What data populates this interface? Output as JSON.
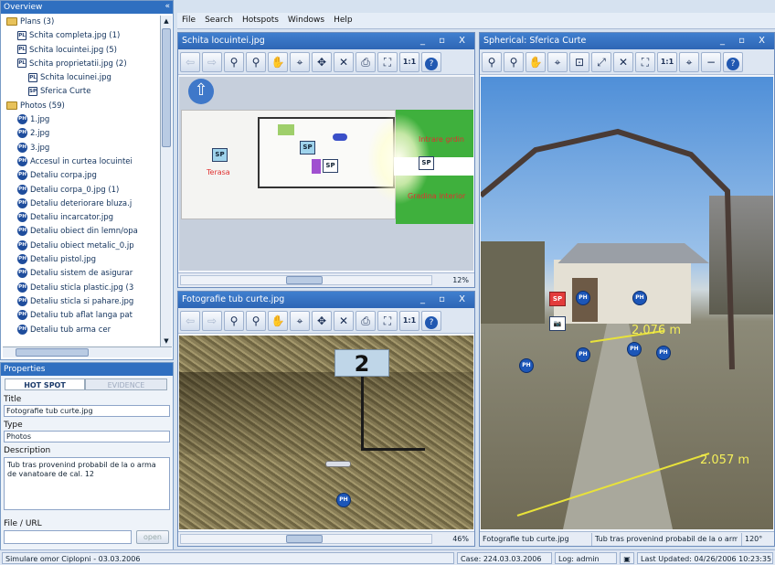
{
  "overview": {
    "title": "Overview",
    "tree": [
      {
        "level": 0,
        "icon": "folder",
        "label": "Plans (3)"
      },
      {
        "level": 1,
        "icon": "PL",
        "label": "Schita completa.jpg (1)"
      },
      {
        "level": 1,
        "icon": "PL",
        "label": "Schita locuintei.jpg (5)"
      },
      {
        "level": 1,
        "icon": "PL",
        "label": "Schita proprietatii.jpg (2)"
      },
      {
        "level": 2,
        "icon": "PL",
        "label": "Schita locuinei.jpg"
      },
      {
        "level": 2,
        "icon": "SP",
        "label": "Sferica Curte"
      },
      {
        "level": 0,
        "icon": "folder",
        "label": "Photos (59)"
      },
      {
        "level": 1,
        "icon": "PH",
        "label": "1.jpg"
      },
      {
        "level": 1,
        "icon": "PH",
        "label": "2.jpg"
      },
      {
        "level": 1,
        "icon": "PH",
        "label": "3.jpg"
      },
      {
        "level": 1,
        "icon": "PH",
        "label": "Accesul in curtea locuintei"
      },
      {
        "level": 1,
        "icon": "PH",
        "label": "Detaliu corpa.jpg"
      },
      {
        "level": 1,
        "icon": "PH",
        "label": "Detaliu corpa_0.jpg (1)"
      },
      {
        "level": 1,
        "icon": "PH",
        "label": "Detaliu deteriorare bluza.j"
      },
      {
        "level": 1,
        "icon": "PH",
        "label": "Detaliu incarcator.jpg"
      },
      {
        "level": 1,
        "icon": "PH",
        "label": "Detaliu obiect din lemn/opa"
      },
      {
        "level": 1,
        "icon": "PH",
        "label": "Detaliu obiect metalic_0.jp"
      },
      {
        "level": 1,
        "icon": "PH",
        "label": "Detaliu pistol.jpg"
      },
      {
        "level": 1,
        "icon": "PH",
        "label": "Detaliu sistem de asigurar"
      },
      {
        "level": 1,
        "icon": "PH",
        "label": "Detaliu sticla plastic.jpg (3"
      },
      {
        "level": 1,
        "icon": "PH",
        "label": "Detaliu sticla si pahare.jpg"
      },
      {
        "level": 1,
        "icon": "PH",
        "label": "Detaliu tub aflat langa pat"
      },
      {
        "level": 1,
        "icon": "PH",
        "label": "Detaliu tub arma cer"
      }
    ]
  },
  "properties": {
    "title": "Properties",
    "tabs": [
      "HOT SPOT",
      "EVIDENCE"
    ],
    "title_label": "Title",
    "title_value": "Fotografie tub curte.jpg",
    "type_label": "Type",
    "type_value": "Photos",
    "description_label": "Description",
    "description_value": "Tub tras provenind probabil de la o arma de vanatoare de cal. 12",
    "file_label": "File / URL",
    "file_value": "",
    "open_label": "open"
  },
  "menu": [
    "File",
    "Search",
    "Hotspots",
    "Windows",
    "Help"
  ],
  "plan_window": {
    "title": "Schita locuintei.jpg",
    "controls": "_ ▫ X",
    "zoom": "12%",
    "labels": {
      "sp1": "SP",
      "sp2": "SP",
      "sp3": "SP",
      "sp4": "SP",
      "red1": "Terasa",
      "red2": "Intrare grdin",
      "red3": "Gradina interior"
    }
  },
  "photo_window": {
    "title": "Fotografie tub curte.jpg",
    "controls": "_ ▫ X",
    "zoom": "46%",
    "sign_number": "2",
    "marker": "PH"
  },
  "sphere_window": {
    "title": "Spherical: Sferica Curte",
    "controls": "_ ▫ X",
    "measure1": "2.076 m",
    "measure2": "2.057 m",
    "sp_label": "SP",
    "ph_label": "PH",
    "status_left": "Fotografie tub curte.jpg",
    "status_mid": "Tub tras provenind probabil de la o arma",
    "status_right": "120°"
  },
  "toolbar_symbols": {
    "back": "⇦",
    "forward": "⇨",
    "zoom_in": "🔍",
    "zoom_out": "🔎",
    "hand": "✋",
    "target": "⌖",
    "move": "✥",
    "delete": "✕",
    "print": "⎙",
    "fit": "⛶",
    "one": "1:1",
    "info": "?",
    "crop": "⊡",
    "measure": "⤢",
    "minus": "−"
  },
  "statusbar": {
    "left": "Simulare omor Ciplopni - 03.03.2006",
    "case": "Case: 224.03.03.2006",
    "login": "Log: admin",
    "updated": "Last Updated: 04/26/2006 10:23:35"
  }
}
